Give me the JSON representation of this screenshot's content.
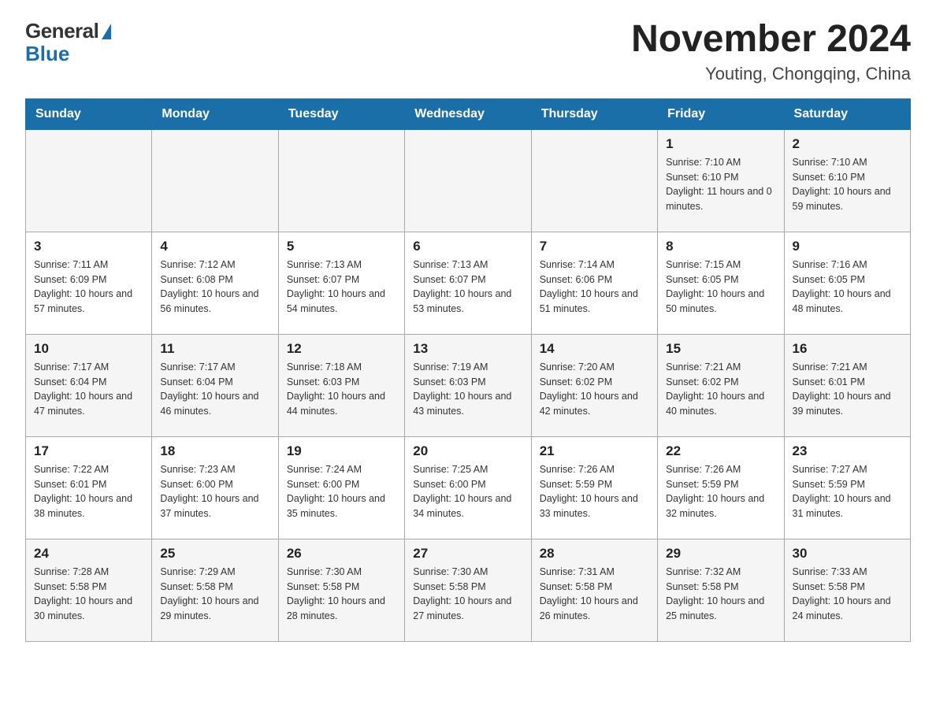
{
  "logo": {
    "general": "General",
    "blue": "Blue"
  },
  "title": "November 2024",
  "subtitle": "Youting, Chongqing, China",
  "days_of_week": [
    "Sunday",
    "Monday",
    "Tuesday",
    "Wednesday",
    "Thursday",
    "Friday",
    "Saturday"
  ],
  "weeks": [
    [
      {
        "day": "",
        "info": ""
      },
      {
        "day": "",
        "info": ""
      },
      {
        "day": "",
        "info": ""
      },
      {
        "day": "",
        "info": ""
      },
      {
        "day": "",
        "info": ""
      },
      {
        "day": "1",
        "info": "Sunrise: 7:10 AM\nSunset: 6:10 PM\nDaylight: 11 hours and 0 minutes."
      },
      {
        "day": "2",
        "info": "Sunrise: 7:10 AM\nSunset: 6:10 PM\nDaylight: 10 hours and 59 minutes."
      }
    ],
    [
      {
        "day": "3",
        "info": "Sunrise: 7:11 AM\nSunset: 6:09 PM\nDaylight: 10 hours and 57 minutes."
      },
      {
        "day": "4",
        "info": "Sunrise: 7:12 AM\nSunset: 6:08 PM\nDaylight: 10 hours and 56 minutes."
      },
      {
        "day": "5",
        "info": "Sunrise: 7:13 AM\nSunset: 6:07 PM\nDaylight: 10 hours and 54 minutes."
      },
      {
        "day": "6",
        "info": "Sunrise: 7:13 AM\nSunset: 6:07 PM\nDaylight: 10 hours and 53 minutes."
      },
      {
        "day": "7",
        "info": "Sunrise: 7:14 AM\nSunset: 6:06 PM\nDaylight: 10 hours and 51 minutes."
      },
      {
        "day": "8",
        "info": "Sunrise: 7:15 AM\nSunset: 6:05 PM\nDaylight: 10 hours and 50 minutes."
      },
      {
        "day": "9",
        "info": "Sunrise: 7:16 AM\nSunset: 6:05 PM\nDaylight: 10 hours and 48 minutes."
      }
    ],
    [
      {
        "day": "10",
        "info": "Sunrise: 7:17 AM\nSunset: 6:04 PM\nDaylight: 10 hours and 47 minutes."
      },
      {
        "day": "11",
        "info": "Sunrise: 7:17 AM\nSunset: 6:04 PM\nDaylight: 10 hours and 46 minutes."
      },
      {
        "day": "12",
        "info": "Sunrise: 7:18 AM\nSunset: 6:03 PM\nDaylight: 10 hours and 44 minutes."
      },
      {
        "day": "13",
        "info": "Sunrise: 7:19 AM\nSunset: 6:03 PM\nDaylight: 10 hours and 43 minutes."
      },
      {
        "day": "14",
        "info": "Sunrise: 7:20 AM\nSunset: 6:02 PM\nDaylight: 10 hours and 42 minutes."
      },
      {
        "day": "15",
        "info": "Sunrise: 7:21 AM\nSunset: 6:02 PM\nDaylight: 10 hours and 40 minutes."
      },
      {
        "day": "16",
        "info": "Sunrise: 7:21 AM\nSunset: 6:01 PM\nDaylight: 10 hours and 39 minutes."
      }
    ],
    [
      {
        "day": "17",
        "info": "Sunrise: 7:22 AM\nSunset: 6:01 PM\nDaylight: 10 hours and 38 minutes."
      },
      {
        "day": "18",
        "info": "Sunrise: 7:23 AM\nSunset: 6:00 PM\nDaylight: 10 hours and 37 minutes."
      },
      {
        "day": "19",
        "info": "Sunrise: 7:24 AM\nSunset: 6:00 PM\nDaylight: 10 hours and 35 minutes."
      },
      {
        "day": "20",
        "info": "Sunrise: 7:25 AM\nSunset: 6:00 PM\nDaylight: 10 hours and 34 minutes."
      },
      {
        "day": "21",
        "info": "Sunrise: 7:26 AM\nSunset: 5:59 PM\nDaylight: 10 hours and 33 minutes."
      },
      {
        "day": "22",
        "info": "Sunrise: 7:26 AM\nSunset: 5:59 PM\nDaylight: 10 hours and 32 minutes."
      },
      {
        "day": "23",
        "info": "Sunrise: 7:27 AM\nSunset: 5:59 PM\nDaylight: 10 hours and 31 minutes."
      }
    ],
    [
      {
        "day": "24",
        "info": "Sunrise: 7:28 AM\nSunset: 5:58 PM\nDaylight: 10 hours and 30 minutes."
      },
      {
        "day": "25",
        "info": "Sunrise: 7:29 AM\nSunset: 5:58 PM\nDaylight: 10 hours and 29 minutes."
      },
      {
        "day": "26",
        "info": "Sunrise: 7:30 AM\nSunset: 5:58 PM\nDaylight: 10 hours and 28 minutes."
      },
      {
        "day": "27",
        "info": "Sunrise: 7:30 AM\nSunset: 5:58 PM\nDaylight: 10 hours and 27 minutes."
      },
      {
        "day": "28",
        "info": "Sunrise: 7:31 AM\nSunset: 5:58 PM\nDaylight: 10 hours and 26 minutes."
      },
      {
        "day": "29",
        "info": "Sunrise: 7:32 AM\nSunset: 5:58 PM\nDaylight: 10 hours and 25 minutes."
      },
      {
        "day": "30",
        "info": "Sunrise: 7:33 AM\nSunset: 5:58 PM\nDaylight: 10 hours and 24 minutes."
      }
    ]
  ]
}
